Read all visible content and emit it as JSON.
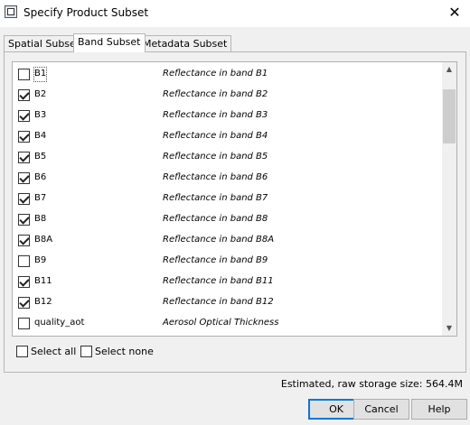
{
  "window": {
    "title": "Specify Product Subset",
    "close_glyph": "✕"
  },
  "tabs": [
    {
      "label": "Spatial Subset",
      "active": false
    },
    {
      "label": "Band Subset",
      "active": true
    },
    {
      "label": "Metadata Subset",
      "active": false
    }
  ],
  "bands": [
    {
      "name": "B1",
      "description": "Reflectance in band B1",
      "checked": false
    },
    {
      "name": "B2",
      "description": "Reflectance in band B2",
      "checked": true
    },
    {
      "name": "B3",
      "description": "Reflectance in band B3",
      "checked": true
    },
    {
      "name": "B4",
      "description": "Reflectance in band B4",
      "checked": true
    },
    {
      "name": "B5",
      "description": "Reflectance in band B5",
      "checked": true
    },
    {
      "name": "B6",
      "description": "Reflectance in band B6",
      "checked": true
    },
    {
      "name": "B7",
      "description": "Reflectance in band B7",
      "checked": true
    },
    {
      "name": "B8",
      "description": "Reflectance in band B8",
      "checked": true
    },
    {
      "name": "B8A",
      "description": "Reflectance in band B8A",
      "checked": true
    },
    {
      "name": "B9",
      "description": "Reflectance in band B9",
      "checked": false
    },
    {
      "name": "B11",
      "description": "Reflectance in band B11",
      "checked": true
    },
    {
      "name": "B12",
      "description": "Reflectance in band B12",
      "checked": true
    },
    {
      "name": "quality_aot",
      "description": "Aerosol Optical Thickness",
      "checked": false
    }
  ],
  "options": {
    "select_all": "Select all",
    "select_none": "Select none"
  },
  "status": "Estimated, raw storage size: 564.4M",
  "buttons": {
    "ok": "OK",
    "cancel": "Cancel",
    "help": "Help"
  }
}
